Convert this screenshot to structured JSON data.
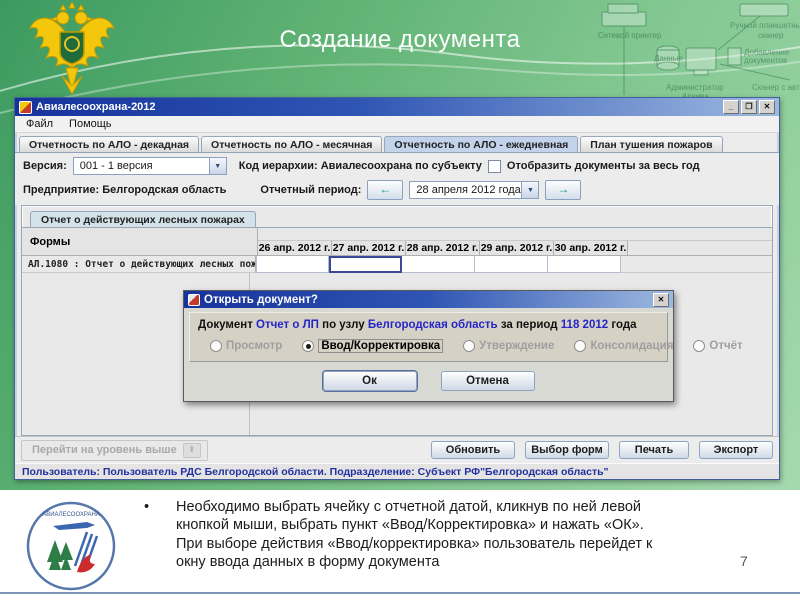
{
  "slide": {
    "title": "Создание документа",
    "page_number": "7",
    "bullet_text": "Необходимо выбрать ячейку с отчетной датой, кликнув по ней левой кнопкой мыши, выбрать пункт «Ввод/Корректировка» и нажать «ОК». При выборе действия «Ввод/корректировка» пользователь перейдет к окну ввода данных в форму документа"
  },
  "icons": {
    "minimize": "_",
    "maximize": "❐",
    "close": "✕",
    "dropdown_arrow": "▼",
    "arrow_left": "←",
    "arrow_right": "→",
    "bullet": "•",
    "up_folder": "⬆"
  },
  "watermark": {
    "printer": "Сетевой принтер",
    "scanner_top_1": "Ручной планшетный",
    "scanner_top_2": "сканер",
    "data": "Данные",
    "add_docs_1": "Добавление",
    "add_docs_2": "документов",
    "admin_1": "Администратор",
    "admin_2": "Архива",
    "scanner_bottom": "Сканер с авто"
  },
  "logo": {
    "text": "АВИАЛЕСООХРАНА"
  },
  "app": {
    "window_title": "Авиалесоохрана-2012",
    "menu": [
      "Файл",
      "Помощь"
    ],
    "tabs": [
      "Отчетность по АЛО - декадная",
      "Отчетность по АЛО - месячная",
      "Отчетность по АЛО - ежедневная",
      "План тушения пожаров"
    ],
    "toolbar": {
      "version_label": "Версия:",
      "version_value": "001 - 1 версия",
      "hierarchy_label": "Код иерархии: Авиалесоохрана по субъекту",
      "show_all_label": "Отобразить документы за весь год",
      "enterprise_label": "Предприятие: Белгородская область",
      "period_label": "Отчетный период:",
      "period_value": "28 апреля  2012 года"
    },
    "inner_tab": "Отчет о действующих лесных пожарах",
    "table": {
      "corner_header": "Формы",
      "date_columns": [
        "26 апр. 2012 г.",
        "27 апр. 2012 г.",
        "28 апр. 2012 г.",
        "29 апр. 2012 г.",
        "30 апр. 2012 г."
      ],
      "row_form": "АЛ.1080 : Отчет о действующих лесных пож..."
    },
    "footer_buttons": {
      "up_level": "Перейти на уровень выше",
      "refresh": "Обновить",
      "form_select": "Выбор форм",
      "print": "Печать",
      "export": "Экспорт"
    },
    "status_bar": "Пользователь: Пользователь  РДС Белгородской области. Подразделение: Субъект РФ\"Белгородская область\""
  },
  "dialog": {
    "title": "Открыть документ?",
    "message": {
      "p1": "Документ ",
      "l1": "Отчет о ЛП",
      "p2": " по узлу ",
      "l2": "Белгородская область",
      "p3": " за период ",
      "l3": "118 2012",
      "p4": " года"
    },
    "radios": [
      {
        "label": "Просмотр",
        "state": "disabled"
      },
      {
        "label": "Ввод/Корректировка",
        "state": "selected"
      },
      {
        "label": "Утверждение",
        "state": "disabled"
      },
      {
        "label": "Консолидация",
        "state": "disabled"
      },
      {
        "label": "Отчёт",
        "state": "disabled"
      }
    ],
    "ok_label": "Ок",
    "cancel_label": "Отмена"
  }
}
